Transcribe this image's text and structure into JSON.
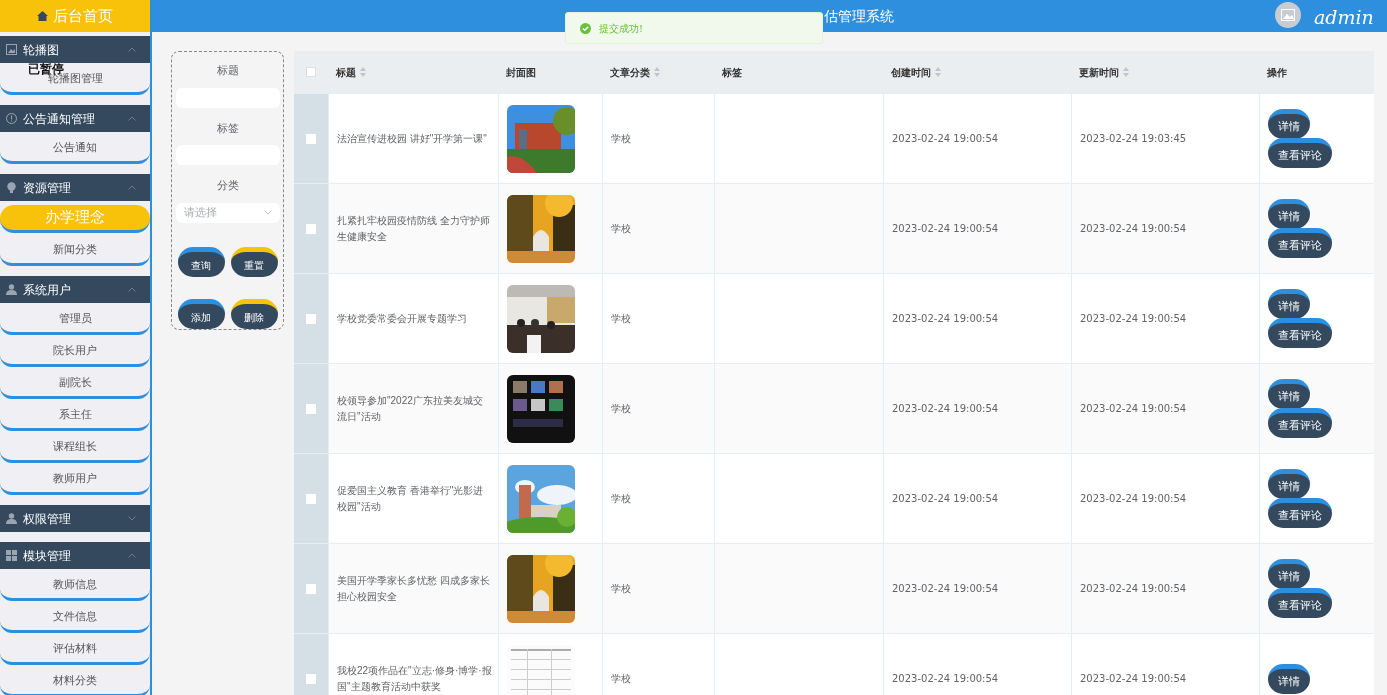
{
  "sidebar": {
    "home": {
      "label": "后台首页"
    },
    "paused_label": "已暂停",
    "groups": [
      {
        "title": "轮播图",
        "expanded": true,
        "items": [
          {
            "label": "轮播图管理",
            "selected": false
          }
        ]
      },
      {
        "title": "公告通知管理",
        "expanded": true,
        "items": [
          {
            "label": "公告通知",
            "selected": false
          }
        ]
      },
      {
        "title": "资源管理",
        "expanded": true,
        "items": [
          {
            "label": "办学理念",
            "selected": true
          },
          {
            "label": "新闻分类",
            "selected": false
          }
        ]
      },
      {
        "title": "系统用户",
        "expanded": true,
        "items": [
          {
            "label": "管理员",
            "selected": false
          },
          {
            "label": "院长用户",
            "selected": false
          },
          {
            "label": "副院长",
            "selected": false
          },
          {
            "label": "系主任",
            "selected": false
          },
          {
            "label": "课程组长",
            "selected": false
          },
          {
            "label": "教师用户",
            "selected": false
          }
        ]
      },
      {
        "title": "权限管理",
        "expanded": false
      },
      {
        "title": "模块管理",
        "expanded": true,
        "items": [
          {
            "label": "教师信息",
            "selected": false
          },
          {
            "label": "文件信息",
            "selected": false
          },
          {
            "label": "评估材料",
            "selected": false
          },
          {
            "label": "材料分类",
            "selected": false
          }
        ]
      }
    ]
  },
  "header": {
    "title": "估管理系统",
    "user": "admin"
  },
  "toast": {
    "message": "提交成功!"
  },
  "search": {
    "fields": [
      {
        "label": "标题",
        "kind": "input"
      },
      {
        "label": "标签",
        "kind": "input"
      },
      {
        "label": "分类",
        "kind": "select",
        "placeholder": "请选择"
      }
    ],
    "buttons": [
      {
        "label": "查询",
        "color": "#2d8fdd"
      },
      {
        "label": "重置",
        "color": "#f8c10a"
      },
      {
        "label": "添加",
        "color": "#2d8fdd"
      },
      {
        "label": "删除",
        "color": "#f8c10a"
      }
    ]
  },
  "table": {
    "select_all_checked": false,
    "columns": [
      {
        "label": "标题",
        "sortable": true
      },
      {
        "label": "封面图",
        "sortable": false
      },
      {
        "label": "文章分类",
        "sortable": true
      },
      {
        "label": "标签",
        "sortable": false
      },
      {
        "label": "创建时间",
        "sortable": true
      },
      {
        "label": "更新时间",
        "sortable": true
      },
      {
        "label": "操作",
        "sortable": false
      }
    ],
    "rows": [
      {
        "checked": false,
        "title": "法治宣传进校园 讲好\"开学第一课\"",
        "cover": {
          "kind": "picture"
        },
        "category": "学校",
        "created": "2023-02-24 19:00:54",
        "updated": "2023-02-24 19:03:45",
        "actions": [
          "详情",
          "查看评论"
        ]
      },
      {
        "checked": false,
        "title": "扎紧扎牢校园疫情防线 全力守护师生健康安全",
        "cover": {
          "kind": "picture"
        },
        "category": "学校",
        "created": "2023-02-24 19:00:54",
        "updated": "2023-02-24 19:00:54",
        "actions": [
          "详情",
          "查看评论"
        ]
      },
      {
        "checked": false,
        "title": "学校党委常委会开展专题学习",
        "cover": {
          "kind": "picture"
        },
        "category": "学校",
        "created": "2023-02-24 19:00:54",
        "updated": "2023-02-24 19:00:54",
        "actions": [
          "详情",
          "查看评论"
        ]
      },
      {
        "checked": false,
        "title": "校领导参加\"2022广东拉美友城交流日\"活动",
        "cover": {
          "kind": "picture"
        },
        "category": "学校",
        "created": "2023-02-24 19:00:54",
        "updated": "2023-02-24 19:00:54",
        "actions": [
          "详情",
          "查看评论"
        ]
      },
      {
        "checked": false,
        "title": "促爱国主义教育 香港举行\"光影进校园\"活动",
        "cover": {
          "kind": "picture"
        },
        "category": "学校",
        "created": "2023-02-24 19:00:54",
        "updated": "2023-02-24 19:00:54",
        "actions": [
          "详情",
          "查看评论"
        ]
      },
      {
        "checked": false,
        "title": "美国开学季家长多忧愁 四成多家长担心校园安全",
        "cover": {
          "kind": "picture"
        },
        "category": "学校",
        "created": "2023-02-24 19:00:54",
        "updated": "2023-02-24 19:00:54",
        "actions": [
          "详情",
          "查看评论"
        ]
      },
      {
        "checked": false,
        "title": "我校22项作品在\"立志·修身·博学·报国\"主题教育活动中获奖",
        "cover": {
          "kind": "picture"
        },
        "category": "学校",
        "created": "2023-02-24 19:00:54",
        "updated": "2023-02-24 19:00:54",
        "actions": [
          "详情"
        ]
      }
    ]
  }
}
